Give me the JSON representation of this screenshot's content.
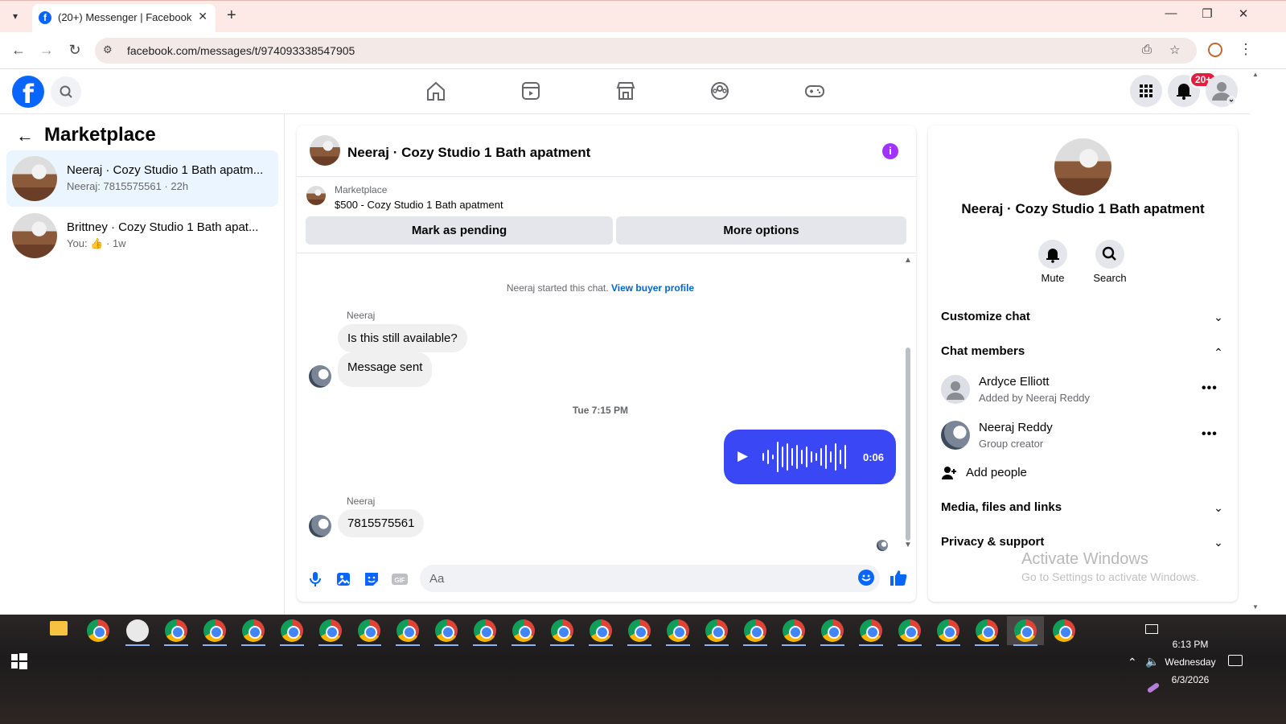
{
  "browser": {
    "tab_title": "(20+) Messenger | Facebook",
    "url": "facebook.com/messages/t/974093338547905"
  },
  "fb_header": {
    "notification_badge": "20+"
  },
  "left_panel": {
    "title": "Marketplace",
    "conversations": [
      {
        "name": "Neeraj · Cozy Studio 1 Bath apatm...",
        "sub": "Neeraj: 7815575561 · 22h",
        "active": true
      },
      {
        "name": "Brittney · Cozy Studio 1 Bath apat...",
        "sub_prefix": "You:",
        "sub_suffix": "· 1w",
        "active": false
      }
    ]
  },
  "chat": {
    "title": "Neeraj · Cozy Studio 1 Bath apatment",
    "marketplace_label": "Marketplace",
    "listing": "$500 - Cozy Studio 1 Bath apatment",
    "mark_pending": "Mark as pending",
    "more_options": "More options",
    "system_message": "Neeraj started this chat.",
    "view_buyer_profile": "View buyer profile",
    "messages": [
      {
        "sender": "Neeraj",
        "text": "Is this still available?"
      },
      {
        "text": "Message sent"
      }
    ],
    "timestamp": "Tue 7:15 PM",
    "voice_duration": "0:06",
    "last_message": {
      "sender": "Neeraj",
      "text": "7815575561"
    },
    "composer_placeholder": "Aa"
  },
  "right_panel": {
    "name": "Neeraj · Cozy Studio 1 Bath apatment",
    "mute": "Mute",
    "search": "Search",
    "customize_chat": "Customize chat",
    "chat_members": "Chat members",
    "members": [
      {
        "name": "Ardyce Elliott",
        "sub": "Added by Neeraj Reddy"
      },
      {
        "name": "Neeraj Reddy",
        "sub": "Group creator"
      }
    ],
    "add_people": "Add people",
    "media": "Media, files and links",
    "privacy": "Privacy & support",
    "activate_title": "Activate Windows",
    "activate_sub": "Go to Settings to activate Windows."
  },
  "taskbar": {
    "time": "6:13 PM",
    "day": "Wednesday",
    "date": "6/3/2026"
  }
}
